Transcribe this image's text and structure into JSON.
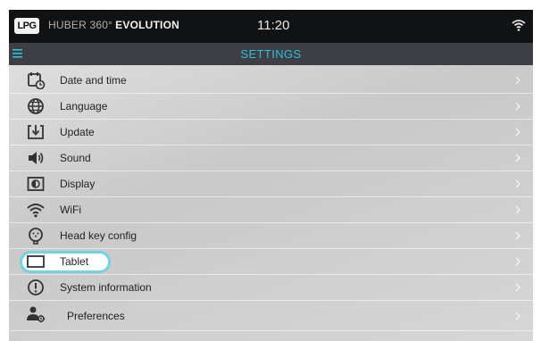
{
  "status_bar": {
    "logo": "LPG",
    "brand_prefix": "HUBER 360°",
    "brand_name": "EVOLUTION",
    "time": "11:20",
    "wifi_icon": "wifi-icon"
  },
  "header": {
    "menu_icon": "hamburger-menu-icon",
    "title": "SETTINGS"
  },
  "settings": {
    "items": [
      {
        "label": "Date and time",
        "icon": "calendar-clock-icon"
      },
      {
        "label": "Language",
        "icon": "globe-icon"
      },
      {
        "label": "Update",
        "icon": "download-icon"
      },
      {
        "label": "Sound",
        "icon": "speaker-icon"
      },
      {
        "label": "Display",
        "icon": "display-icon"
      },
      {
        "label": "WiFi",
        "icon": "wifi-icon"
      },
      {
        "label": "Head key config",
        "icon": "head-key-icon"
      },
      {
        "label": "Tablet",
        "icon": "tablet-icon",
        "highlighted": true
      },
      {
        "label": "System information",
        "icon": "info-icon"
      },
      {
        "label": "Preferences",
        "icon": "user-settings-icon"
      }
    ]
  },
  "colors": {
    "accent": "#2ebfd9",
    "highlight_ring": "#6fd3e2",
    "status_bar_bg": "#111214",
    "title_bar_bg": "#3e3f44"
  }
}
